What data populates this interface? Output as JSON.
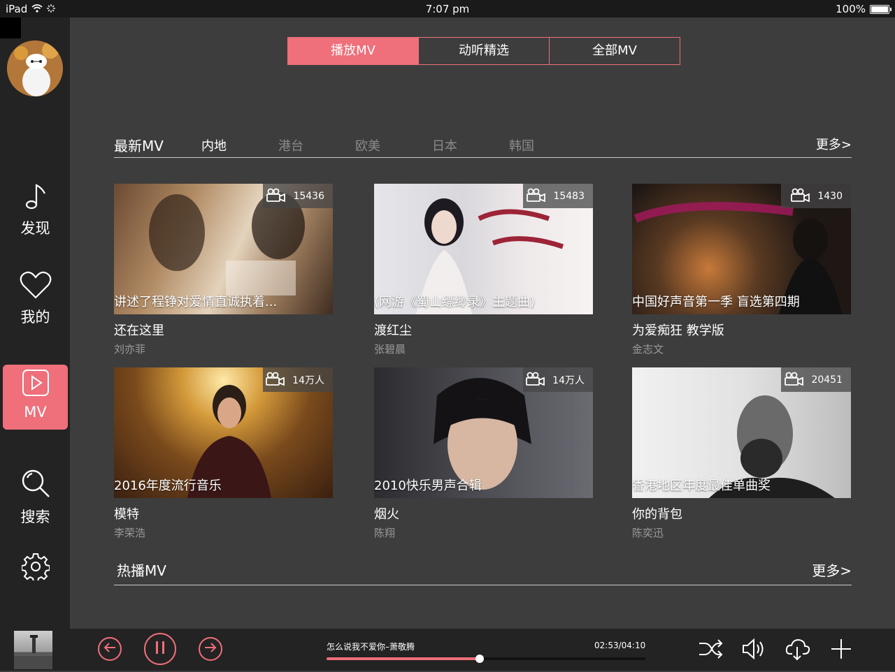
{
  "status": {
    "device": "iPad",
    "time": "7:07 pm",
    "battery": "100%"
  },
  "sidebar": {
    "items": [
      {
        "label": "发现",
        "icon": "music-note-icon"
      },
      {
        "label": "我的",
        "icon": "heart-icon"
      },
      {
        "label": "MV",
        "icon": "play-icon",
        "active": true
      },
      {
        "label": "搜索",
        "icon": "search-icon"
      },
      {
        "label": "",
        "icon": "gear-icon"
      }
    ]
  },
  "top_tabs": [
    {
      "label": "播放MV",
      "active": true
    },
    {
      "label": "动听精选",
      "active": false
    },
    {
      "label": "全部MV",
      "active": false
    }
  ],
  "latest": {
    "title": "最新MV",
    "more": "更多>",
    "regions": [
      {
        "label": "内地",
        "active": true
      },
      {
        "label": "港台",
        "active": false
      },
      {
        "label": "欧美",
        "active": false
      },
      {
        "label": "日本",
        "active": false
      },
      {
        "label": "韩国",
        "active": false
      }
    ],
    "cards": [
      {
        "count": "15436",
        "caption": "讲述了程铮对爱情直诚执着...",
        "name": "还在这里",
        "artist": "刘亦菲"
      },
      {
        "count": "15483",
        "caption": "(网游《蜀山缥缈录》主题曲)",
        "name": "渡红尘",
        "artist": "张碧晨"
      },
      {
        "count": "1430",
        "caption": "中国好声音第一季 盲选第四期",
        "name": "为爱痴狂  教学版",
        "artist": "金志文"
      },
      {
        "count": "14万人",
        "caption": "2016年度流行音乐",
        "name": "模特",
        "artist": "李荣浩"
      },
      {
        "count": "14万人",
        "caption": "2010快乐男声合辑",
        "name": "烟火",
        "artist": "陈翔"
      },
      {
        "count": "20451",
        "caption": "香港地区年度最佳单曲奖",
        "name": "你的背包",
        "artist": "陈奕迅"
      }
    ]
  },
  "hot": {
    "title": "热播MV",
    "more": "更多>"
  },
  "player": {
    "song": "怎么说我不爱你–萧敬腾",
    "time": "02:53/04:10",
    "progress": 0.48
  },
  "colors": {
    "accent": "#ef6f7a",
    "background": "#3d3d3d",
    "sidebar": "#232323"
  }
}
